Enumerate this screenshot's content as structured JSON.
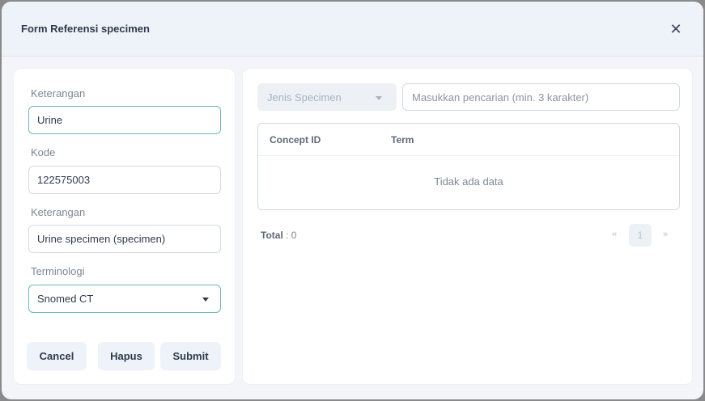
{
  "modal": {
    "title": "Form Referensi specimen",
    "close_glyph": "✕"
  },
  "form": {
    "fields": [
      {
        "label": "Keterangan",
        "value": "Urine"
      },
      {
        "label": "Kode",
        "value": "122575003"
      },
      {
        "label": "Keterangan",
        "value": "Urine specimen (specimen)"
      },
      {
        "label": "Terminologi",
        "value": "Snomed CT"
      }
    ],
    "buttons": {
      "cancel": "Cancel",
      "delete": "Hapus",
      "submit": "Submit"
    }
  },
  "search": {
    "type_select": "Jenis Specimen",
    "placeholder": "Masukkan pencarian (min. 3 karakter)"
  },
  "table": {
    "columns": [
      "Concept ID",
      "Term"
    ],
    "empty_text": "Tidak ada data"
  },
  "footer": {
    "total_label": "Total",
    "total_sep": " : ",
    "total_value": "0"
  },
  "pagination": {
    "prev": "«",
    "page": "1",
    "next": "»"
  },
  "colors": {
    "accent_border": "#6fb7bb",
    "button_bg": "#eef3fa"
  }
}
